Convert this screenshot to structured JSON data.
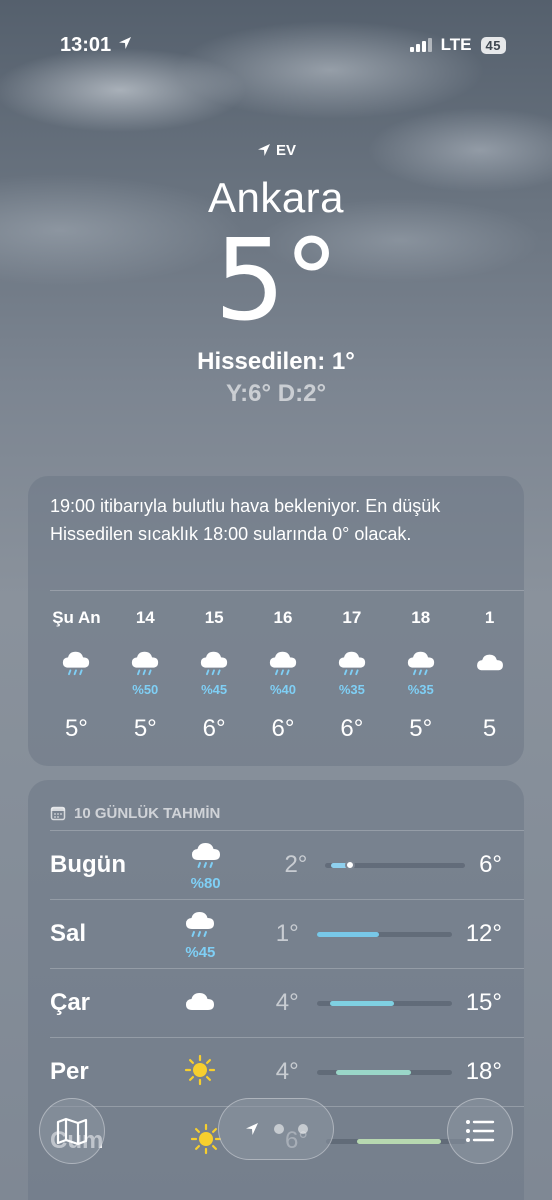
{
  "status": {
    "time": "13:01",
    "network": "LTE",
    "battery": "45"
  },
  "location": {
    "home_label": "EV",
    "city": "Ankara",
    "temperature": "5°",
    "feels_like": "Hissedilen: 1°",
    "high_low": "Y:6° D:2°"
  },
  "hourly": {
    "summary": "19:00 itibarıyla bulutlu hava bekleniyor. En düşük Hissedilen sıcaklık 18:00 sularında 0° olacak.",
    "hours": [
      {
        "label": "Şu An",
        "icon": "rain-cloud-icon",
        "pop": "",
        "temp": "5°"
      },
      {
        "label": "14",
        "icon": "rain-cloud-icon",
        "pop": "%50",
        "temp": "5°"
      },
      {
        "label": "15",
        "icon": "rain-cloud-icon",
        "pop": "%45",
        "temp": "6°"
      },
      {
        "label": "16",
        "icon": "rain-cloud-icon",
        "pop": "%40",
        "temp": "6°"
      },
      {
        "label": "17",
        "icon": "rain-cloud-icon",
        "pop": "%35",
        "temp": "6°"
      },
      {
        "label": "18",
        "icon": "rain-cloud-icon",
        "pop": "%35",
        "temp": "5°"
      },
      {
        "label": "1",
        "icon": "cloud-icon",
        "pop": "",
        "temp": "5"
      }
    ]
  },
  "daily": {
    "header": "10 GÜNLÜK TAHMİN",
    "days": [
      {
        "name": "Bugün",
        "icon": "rain-cloud-icon",
        "pop": "%80",
        "low": "2°",
        "high": "6°",
        "range_start": 0.04,
        "range_end": 0.16,
        "bar_color": "#8fd0ee",
        "current_marker": 0.14
      },
      {
        "name": "Sal",
        "icon": "rain-cloud-icon",
        "pop": "%45",
        "low": "1°",
        "high": "12°",
        "range_start": 0.0,
        "range_end": 0.46,
        "bar_color": "#78c8e8"
      },
      {
        "name": "Çar",
        "icon": "cloud-icon",
        "pop": "",
        "low": "4°",
        "high": "15°",
        "range_start": 0.1,
        "range_end": 0.57,
        "bar_color": "#7fd0e2"
      },
      {
        "name": "Per",
        "icon": "sun-icon",
        "pop": "",
        "low": "4°",
        "high": "18°",
        "range_start": 0.14,
        "range_end": 0.7,
        "bar_color": "#9ad6c8"
      },
      {
        "name": "Cum",
        "icon": "sun-icon",
        "pop": "",
        "low": "6°",
        "high": "",
        "range_start": 0.22,
        "range_end": 0.82,
        "bar_color": "#b7d8b0"
      }
    ]
  },
  "toolbar": {
    "map_icon": "map-icon",
    "location_icon": "location-arrow-icon",
    "list_icon": "list-icon"
  }
}
